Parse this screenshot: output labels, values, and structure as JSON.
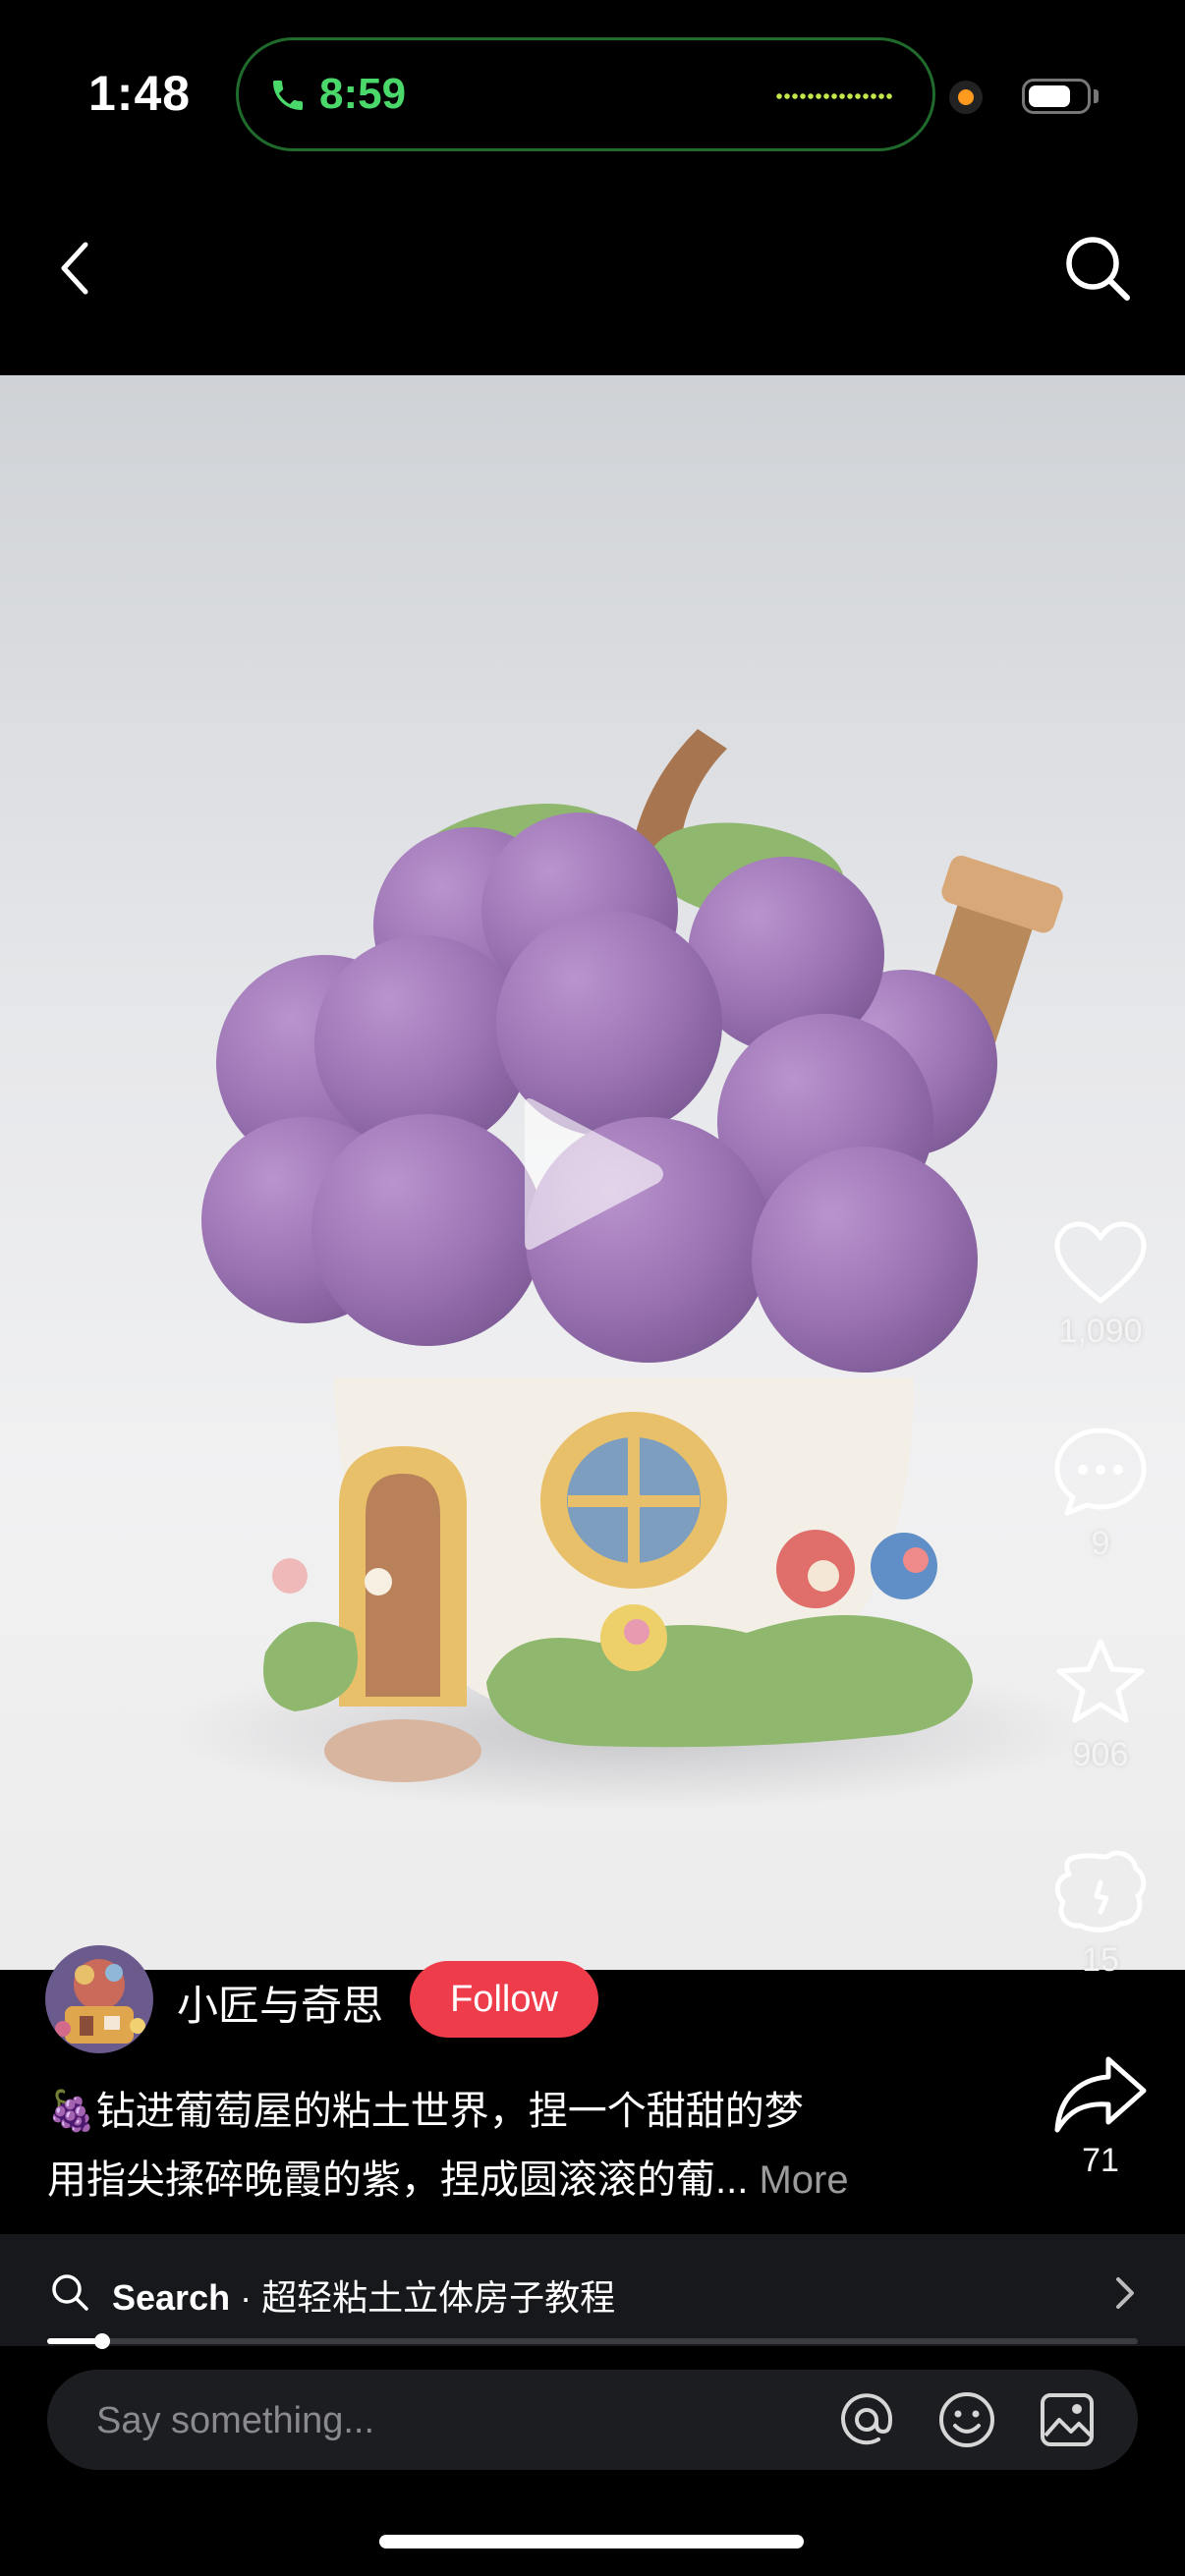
{
  "status_bar": {
    "time": "1:48",
    "call_timer": "8:59",
    "battery_level": 0.75
  },
  "nav": {
    "back_icon": "chevron-left-icon",
    "search_icon": "search-icon"
  },
  "media": {
    "type": "video",
    "play_icon": "play-icon"
  },
  "actions": {
    "likes": "1,090",
    "comments": "9",
    "favorites": "906",
    "gifts": "15",
    "shares": "71"
  },
  "author": {
    "name": "小匠与奇思",
    "follow_label": "Follow"
  },
  "caption": {
    "line1": "🍇钻进葡萄屋的粘土世界，捏一个甜甜的梦",
    "line2": "用指尖揉碎晚霞的紫，捏成圆滚滚的葡...",
    "more_label": "More"
  },
  "search_bar": {
    "label": "Search",
    "separator": " · ",
    "query": "超轻粘土立体房子教程"
  },
  "playback": {
    "progress": 0.05
  },
  "comment": {
    "placeholder": "Say something..."
  },
  "colors": {
    "follow_red": "#ee3c4b",
    "island_green": "#4ad86b",
    "grape_purple": "#a07ab8"
  }
}
